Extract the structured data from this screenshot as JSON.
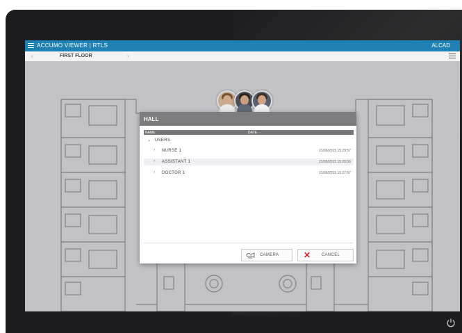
{
  "app": {
    "title": "ACCUMO VIEWER | RTLS",
    "user": "ALCAD"
  },
  "location": {
    "floor": "FIRST FLOOR"
  },
  "dialog": {
    "title": "HALL",
    "columns": {
      "name": "NAME",
      "date": "DATE"
    },
    "group": "USERS",
    "rows": [
      {
        "label": "NURSE 1",
        "date": "21/06/2015 15:29:57"
      },
      {
        "label": "ASSISTANT 1",
        "date": "21/06/2015 15:28:56"
      },
      {
        "label": "DOCTOR 1",
        "date": "21/06/2015 15:27:57"
      }
    ],
    "buttons": {
      "camera": "CAMERA",
      "cancel": "CANCEL"
    }
  },
  "colors": {
    "app_bar": "#1f80b4",
    "dialog_header": "#7d7d80",
    "cancel_icon": "#d8222a",
    "device_frame": "#1d1d1f"
  },
  "icons": [
    "menu-icon",
    "settings-icon",
    "chevron-left-icon",
    "chevron-right-icon",
    "chevron-down-icon",
    "camera-icon",
    "close-icon",
    "power-icon"
  ]
}
